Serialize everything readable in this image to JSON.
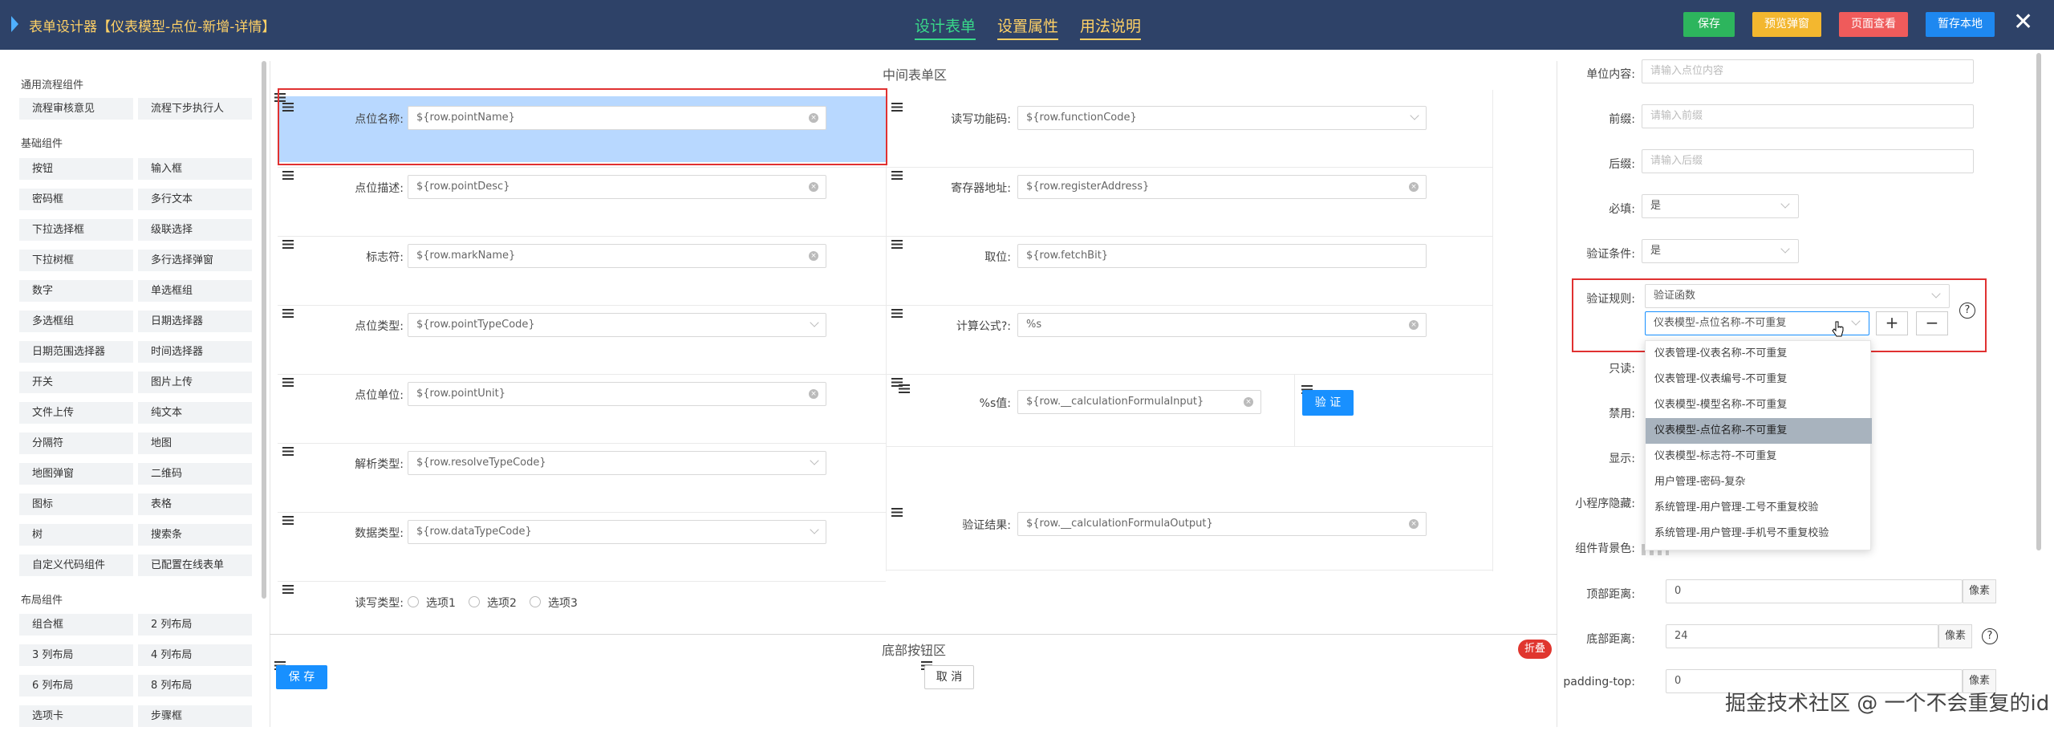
{
  "header": {
    "title": "表单设计器【仪表模型-点位-新增-详情】",
    "tabs": [
      "设计表单",
      "设置属性",
      "用法说明"
    ],
    "buttons": [
      {
        "label": "保存",
        "color": "#2db55d"
      },
      {
        "label": "预览弹窗",
        "color": "#f3b72f"
      },
      {
        "label": "页面查看",
        "color": "#ef5b5b"
      },
      {
        "label": "暂存本地",
        "color": "#1e88f0"
      }
    ],
    "close_icon": "close-icon"
  },
  "left_panel": {
    "sections": [
      {
        "title": "通用流程组件",
        "items": [
          "流程审核意见",
          "流程下步执行人"
        ]
      },
      {
        "title": "基础组件",
        "items": [
          "按钮",
          "输入框",
          "密码框",
          "多行文本",
          "下拉选择框",
          "级联选择",
          "下拉树框",
          "多行选择弹窗",
          "数字",
          "单选框组",
          "多选框组",
          "日期选择器",
          "日期范围选择器",
          "时间选择器",
          "开关",
          "图片上传",
          "文件上传",
          "纯文本",
          "分隔符",
          "地图",
          "地图弹窗",
          "二维码",
          "图标",
          "表格",
          "树",
          "搜索条",
          "自定义代码组件",
          "已配置在线表单"
        ]
      },
      {
        "title": "布局组件",
        "items": [
          "组合框",
          "2 列布局",
          "3 列布局",
          "4 列布局",
          "6 列布局",
          "8 列布局",
          "选项卡",
          "步骤框"
        ]
      }
    ]
  },
  "canvas": {
    "middle_title": "中间表单区",
    "bottom_title": "底部按钮区",
    "fold_label": "折叠",
    "left_fields": [
      {
        "label": "点位名称:",
        "value": "${row.pointName}",
        "suffix": "clear"
      },
      {
        "label": "点位描述:",
        "value": "${row.pointDesc}",
        "suffix": "clear"
      },
      {
        "label": "标志符:",
        "value": "${row.markName}",
        "suffix": "clear"
      },
      {
        "label": "点位类型:",
        "value": "${row.pointTypeCode}",
        "suffix": "chevron"
      },
      {
        "label": "点位单位:",
        "value": "${row.pointUnit}",
        "suffix": "clear"
      },
      {
        "label": "解析类型:",
        "value": "${row.resolveTypeCode}",
        "suffix": "chevron"
      },
      {
        "label": "数据类型:",
        "value": "${row.dataTypeCode}",
        "suffix": "chevron"
      }
    ],
    "rw_type": {
      "label": "读写类型:",
      "options": [
        "选项1",
        "选项2",
        "选项3"
      ]
    },
    "right_fields": [
      {
        "label": "读写功能码:",
        "value": "${row.functionCode}",
        "suffix": "chevron"
      },
      {
        "label": "寄存器地址:",
        "value": "${row.registerAddress}",
        "suffix": "clear"
      },
      {
        "label": "取位:",
        "value": "${row.fetchBit}",
        "suffix": "none"
      },
      {
        "label": "计算公式?:",
        "value": "%s",
        "suffix": "clear"
      },
      {
        "label": "%s值:",
        "value": "${row.__calculationFormulaInput}",
        "suffix": "clear"
      },
      {
        "label": "验证结果:",
        "value": "${row.__calculationFormulaOutput}",
        "suffix": "clear"
      }
    ],
    "verify_button": "验 证",
    "footer_save": "保 存",
    "footer_cancel": "取 消"
  },
  "props": {
    "rows": [
      {
        "label": "单位内容:",
        "placeholder": "请输入点位内容"
      },
      {
        "label": "前缀:",
        "placeholder": "请输入前缀"
      },
      {
        "label": "后缀:",
        "placeholder": "请输入后缀"
      }
    ],
    "required": {
      "label": "必填:",
      "value": "是"
    },
    "verify_cond": {
      "label": "验证条件:",
      "value": "是"
    },
    "verify_rule": {
      "label": "验证规则:",
      "func": "验证函数",
      "value": "仪表模型-点位名称-不可重复",
      "plus": "+",
      "minus": "−",
      "help": "?"
    },
    "readonly": {
      "label": "只读:"
    },
    "disabled": {
      "label": "禁用:"
    },
    "show": {
      "label": "显示:"
    },
    "mini_hide": {
      "label": "小程序隐藏:"
    },
    "bg": {
      "label": "组件背景色:"
    },
    "top": {
      "label": "顶部距离:",
      "value": "0",
      "unit": "像素"
    },
    "bottom": {
      "label": "底部距离:",
      "value": "24",
      "unit": "像素",
      "help": "?"
    },
    "ptop": {
      "label": "padding-top:",
      "value": "0",
      "unit": "像素"
    },
    "dropdown": [
      "仪表管理-仪表名称-不可重复",
      "仪表管理-仪表编号-不可重复",
      "仪表模型-模型名称-不可重复",
      "仪表模型-点位名称-不可重复",
      "仪表模型-标志符-不可重复",
      "用户管理-密码-复杂",
      "系统管理-用户管理-工号不重复校验",
      "系统管理-用户管理-手机号不重复校验"
    ],
    "dropdown_selected": 3
  },
  "watermark": "掘金技术社区 @ 一个不会重复的id"
}
